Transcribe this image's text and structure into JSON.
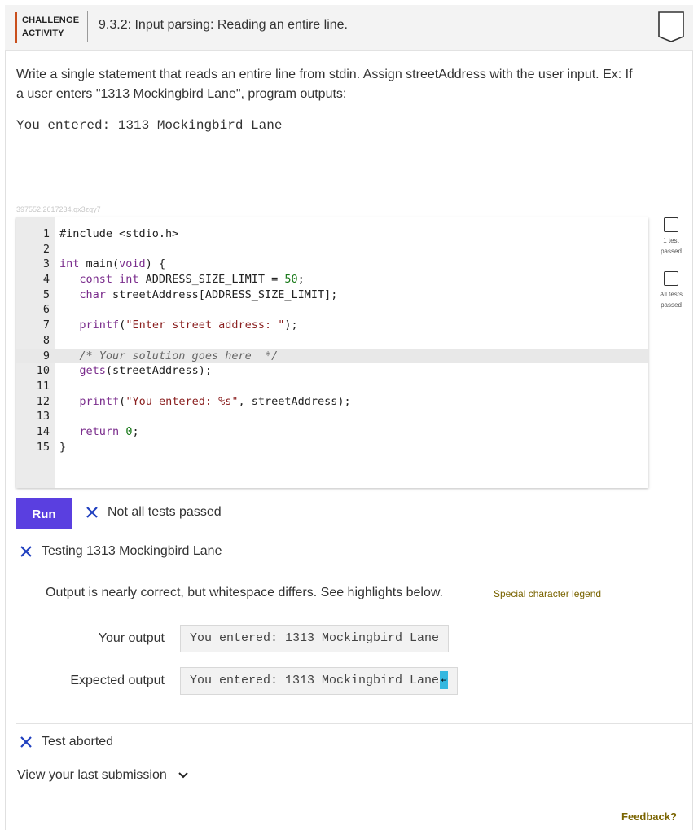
{
  "header": {
    "badge_line1": "CHALLENGE",
    "badge_line2": "ACTIVITY",
    "title": "9.3.2: Input parsing: Reading an entire line."
  },
  "prompt": {
    "text": "Write a single statement that reads an entire line from stdin. Assign streetAddress with the user input. Ex: If a user enters \"1313 Mockingbird Lane\", program outputs:",
    "sample_output": "You entered: 1313 Mockingbird Lane"
  },
  "activity_id": "397552.2617234.qx3zqy7",
  "code": {
    "line_numbers": [
      "1",
      "2",
      "3",
      "4",
      "5",
      "6",
      "7",
      "8",
      "9",
      "10",
      "11",
      "12",
      "13",
      "14",
      "15"
    ]
  },
  "test_status": {
    "one_test": "1 test passed",
    "all_tests": "All tests passed"
  },
  "run": {
    "label": "Run",
    "result": "Not all tests passed"
  },
  "test": {
    "title": "Testing 1313 Mockingbird Lane",
    "message": "Output is nearly correct, but whitespace differs. See highlights below.",
    "legend_link": "Special character legend",
    "your_output_label": "Your output",
    "your_output": "You entered: 1313 Mockingbird Lane",
    "expected_output_label": "Expected output",
    "expected_output": "You entered: 1313 Mockingbird Lane"
  },
  "aborted": "Test aborted",
  "last_submission": "View your last submission",
  "feedback": "Feedback?",
  "colors": {
    "accent": "#5a3fe0",
    "error_x": "#1f3fbf",
    "badge_bar": "#c94f1d",
    "link": "#7a6400",
    "newline_highlight": "#35b8e0"
  }
}
